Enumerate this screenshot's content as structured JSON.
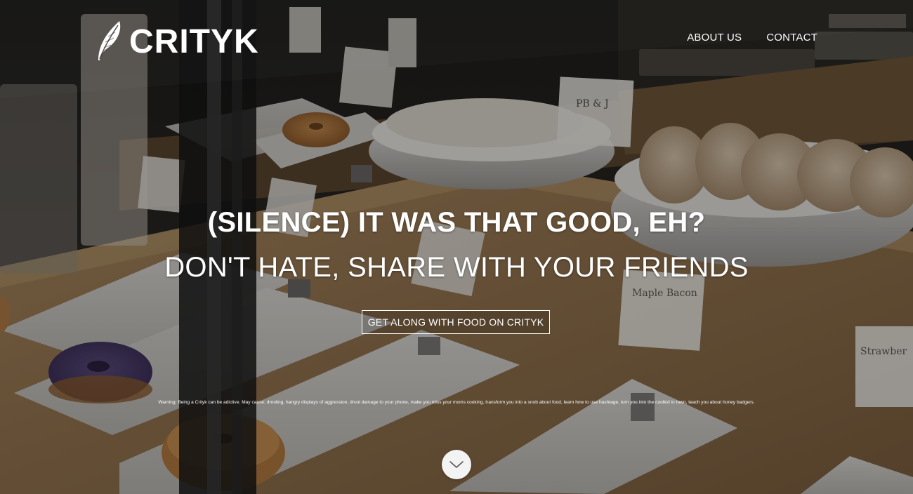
{
  "brand": {
    "name": "CRITYK",
    "icon": "feather-icon"
  },
  "nav": {
    "items": [
      {
        "label": "ABOUT US"
      },
      {
        "label": "CONTACT"
      }
    ]
  },
  "hero": {
    "headline": "(SILENCE) IT WAS THAT GOOD, EH?",
    "subheadline": "DON'T HATE, SHARE WITH YOUR FRIENDS",
    "cta_label": "GET ALONG WITH FOOD ON CRITYK",
    "warning": "Warning: Being a Crityk can be adictive. May cause; drooling, hangry displays of aggression, drool damage to your phone, make you miss your moms cooking, transform you into a snob about food, learn how to use hashtage, turn you into the coolkid in town, teach you about honey badgers.",
    "scroll_icon": "chevron-down-icon"
  },
  "background": {
    "signs": [
      "PB & J",
      "Maple Bacon",
      "Strawber"
    ]
  },
  "colors": {
    "text": "#ffffff",
    "overlay": "rgba(0,0,0,0.32)",
    "scroll_button": "#f3f3f3"
  }
}
